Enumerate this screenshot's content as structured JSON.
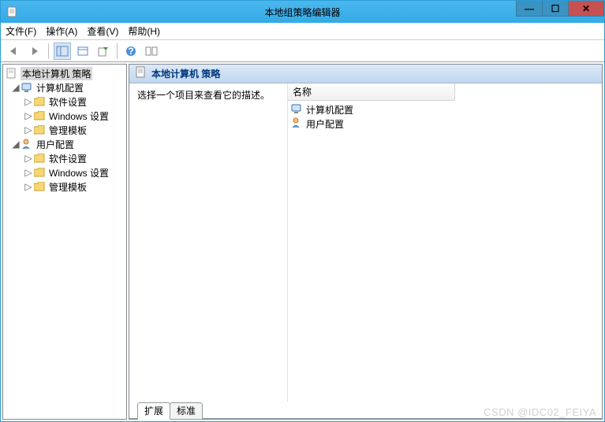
{
  "window": {
    "title": "本地组策略编辑器"
  },
  "menubar": {
    "file": "文件(F)",
    "action": "操作(A)",
    "view": "查看(V)",
    "help": "帮助(H)"
  },
  "tree": {
    "root": "本地计算机 策略",
    "computer": {
      "label": "计算机配置",
      "software": "软件设置",
      "windows": "Windows 设置",
      "templates": "管理模板"
    },
    "user": {
      "label": "用户配置",
      "software": "软件设置",
      "windows": "Windows 设置",
      "templates": "管理模板"
    }
  },
  "detail": {
    "header": "本地计算机 策略",
    "description": "选择一个项目来查看它的描述。",
    "column": "名称",
    "items": {
      "computer": "计算机配置",
      "user": "用户配置"
    }
  },
  "tabs": {
    "extended": "扩展",
    "standard": "标准"
  },
  "watermark": "CSDN @IDC02_FEIYA"
}
